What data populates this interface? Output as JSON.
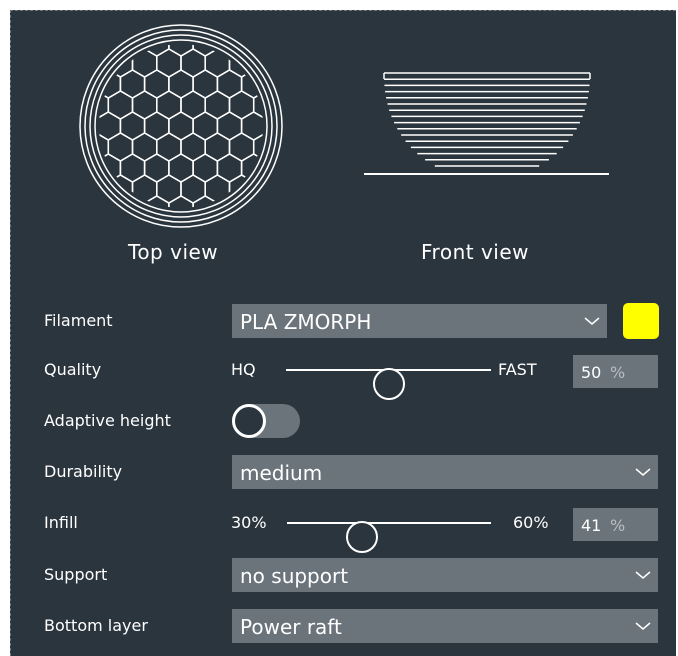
{
  "previews": {
    "top_view_label": "Top view",
    "front_view_label": "Front view"
  },
  "settings": {
    "filament": {
      "label": "Filament",
      "value": "PLA ZMORPH",
      "color": "#ffff00"
    },
    "quality": {
      "label": "Quality",
      "min_label": "HQ",
      "max_label": "FAST",
      "value": "50",
      "unit": "%",
      "level_fraction": 0.5
    },
    "adaptive_height": {
      "label": "Adaptive height",
      "enabled": false
    },
    "durability": {
      "label": "Durability",
      "value": "medium"
    },
    "infill": {
      "label": "Infill",
      "min_label": "30%",
      "max_label": "60%",
      "value": "41",
      "unit": "%",
      "level_fraction": 0.367
    },
    "support": {
      "label": "Support",
      "value": "no support"
    },
    "bottom_layer": {
      "label": "Bottom layer",
      "value": "Power raft"
    }
  },
  "icons": {
    "dropdown": "chevron-down-icon"
  },
  "colors": {
    "panel_background": "#2a353d",
    "control_background": "#6b747b",
    "filament_color": "#ffff00"
  }
}
